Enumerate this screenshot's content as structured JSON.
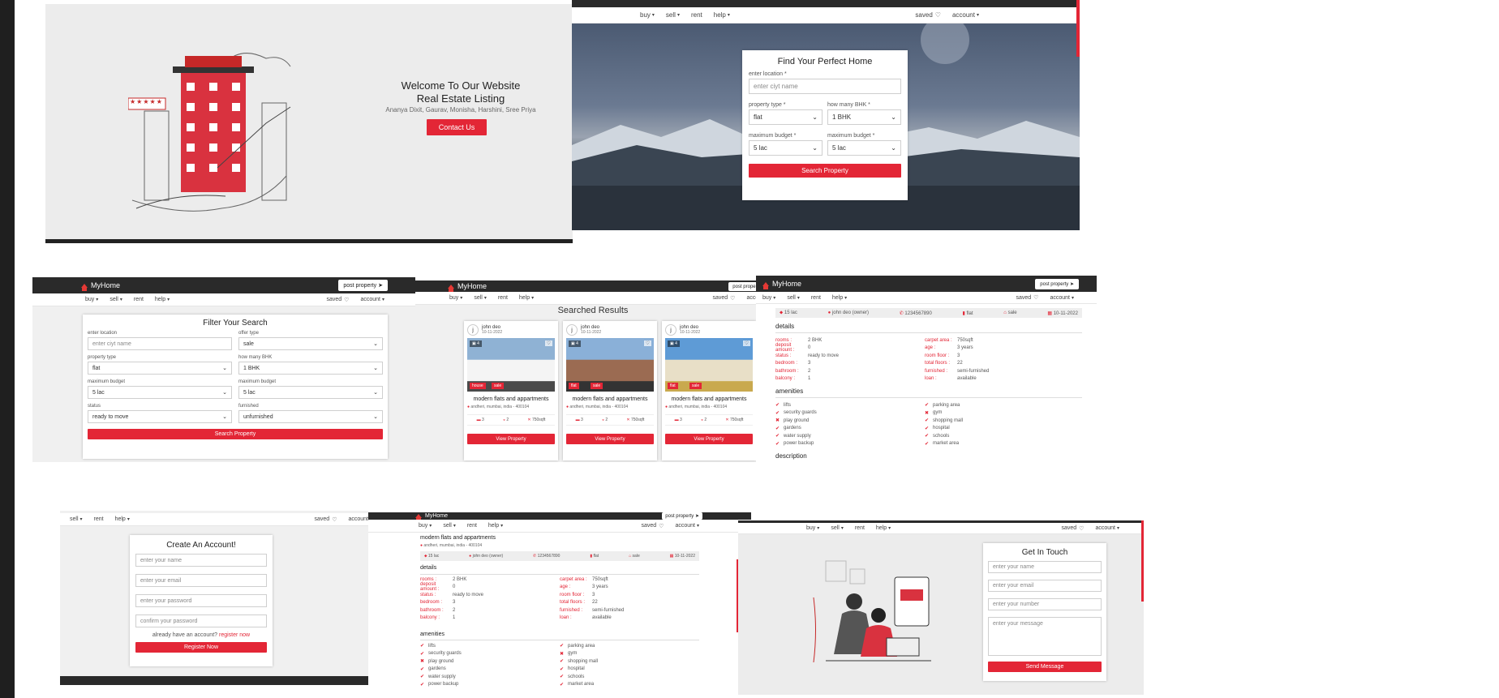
{
  "welcome": {
    "title_line1": "Welcome To Our Website",
    "title_line2": "Real Estate Listing",
    "authors": "Ananya Dixit, Gaurav, Monisha, Harshini, Sree Priya",
    "contact_button": "Contact Us",
    "stars": "★★★★★"
  },
  "nav": {
    "buy": "buy",
    "sell": "sell",
    "rent": "rent",
    "help": "help",
    "saved": "saved",
    "account": "account",
    "brand": "MyHome",
    "post_property": "post property"
  },
  "hero_search": {
    "title": "Find Your Perfect Home",
    "location_label": "enter location *",
    "location_placeholder": "enter ciyt name",
    "property_type_label": "property type *",
    "property_type_value": "flat",
    "bhk_label": "how many BHK *",
    "bhk_value": "1 BHK",
    "budget_label_1": "maximum budget *",
    "budget_value_1": "5 lac",
    "budget_label_2": "maximum budget *",
    "budget_value_2": "5 lac",
    "button": "Search Property"
  },
  "filter": {
    "title": "Filter Your Search",
    "location_label": "enter location",
    "location_placeholder": "enter ciyt name",
    "offer_label": "offer type",
    "offer_value": "sale",
    "ptype_label": "property type",
    "ptype_value": "flat",
    "bhk_label": "how many BHK",
    "bhk_value": "1 BHK",
    "budget_label_1": "maximum budget",
    "budget_value_1": "5 lac",
    "budget_label_2": "maximum budget",
    "budget_value_2": "5 lac",
    "status_label": "status",
    "status_value": "ready to move",
    "furnished_label": "furnished",
    "furnished_value": "unfurnished",
    "button": "Search Property"
  },
  "results": {
    "title": "Searched Results",
    "cards": [
      {
        "avatar": "j",
        "owner": "john deo",
        "date": "10-11-2022",
        "img_count": "4",
        "tag1": "house",
        "tag2": "sale",
        "name": "modern flats and appartments",
        "address": "andheri, mumbai, india - 400104",
        "beds": "3",
        "baths": "2",
        "area": "750sqft",
        "button": "View Property",
        "img": "house"
      },
      {
        "avatar": "j",
        "owner": "john deo",
        "date": "10-11-2022",
        "img_count": "4",
        "tag1": "flat",
        "tag2": "sale",
        "name": "modern flats and appartments",
        "address": "andheri, mumbai, india - 400104",
        "beds": "3",
        "baths": "2",
        "area": "750sqft",
        "button": "View Property",
        "img": "apart"
      },
      {
        "avatar": "j",
        "owner": "john deo",
        "date": "10-11-2022",
        "img_count": "4",
        "tag1": "flat",
        "tag2": "sale",
        "name": "modern flats and appartments",
        "address": "andheri, mumbai, india - 400104",
        "beds": "3",
        "baths": "2",
        "area": "750sqft",
        "button": "View Property",
        "img": "tower"
      }
    ]
  },
  "detail": {
    "name": "modern flats and appartments",
    "address": "andheri, mumbai, india - 400104",
    "price": "15 lac",
    "owner": "john deo (owner)",
    "phone": "1234567890",
    "type": "flat",
    "offer": "sale",
    "date": "10-11-2022",
    "details_title": "details",
    "left": [
      {
        "k": "rooms :",
        "v": "2 BHK"
      },
      {
        "k": "deposit amount :",
        "v": "0"
      },
      {
        "k": "status :",
        "v": "ready to move"
      },
      {
        "k": "bedroom :",
        "v": "3"
      },
      {
        "k": "bathroom :",
        "v": "2"
      },
      {
        "k": "balcony :",
        "v": "1"
      }
    ],
    "right": [
      {
        "k": "carpet area :",
        "v": "750sqft"
      },
      {
        "k": "age :",
        "v": "3 years"
      },
      {
        "k": "room floor :",
        "v": "3"
      },
      {
        "k": "total floors :",
        "v": "22"
      },
      {
        "k": "furnished :",
        "v": "semi-furnished"
      },
      {
        "k": "loan :",
        "v": "available"
      }
    ],
    "amenities_title": "amenities",
    "amen_left": [
      {
        "name": "lifts",
        "ok": true
      },
      {
        "name": "security guards",
        "ok": true
      },
      {
        "name": "play ground",
        "ok": false
      },
      {
        "name": "gardens",
        "ok": true
      },
      {
        "name": "water supply",
        "ok": true
      },
      {
        "name": "power backup",
        "ok": true
      }
    ],
    "amen_right": [
      {
        "name": "parking area",
        "ok": true
      },
      {
        "name": "gym",
        "ok": false
      },
      {
        "name": "shopping mall",
        "ok": true
      },
      {
        "name": "hospital",
        "ok": true
      },
      {
        "name": "schools",
        "ok": true
      },
      {
        "name": "market area",
        "ok": true
      }
    ],
    "description_title": "description"
  },
  "register": {
    "title": "Create An Account!",
    "name_ph": "enter your name",
    "email_ph": "enter your email",
    "pass_ph": "enter your password",
    "confirm_ph": "confirm your password",
    "already": "already have an account?",
    "login_link": "register now",
    "button": "Register Now"
  },
  "contact": {
    "title": "Get In Touch",
    "name_ph": "enter your name",
    "email_ph": "enter your email",
    "number_ph": "enter your number",
    "message_ph": "enter your message",
    "button": "Send Message"
  },
  "colors": {
    "accent": "#e32636",
    "dark": "#2a2a2a"
  }
}
